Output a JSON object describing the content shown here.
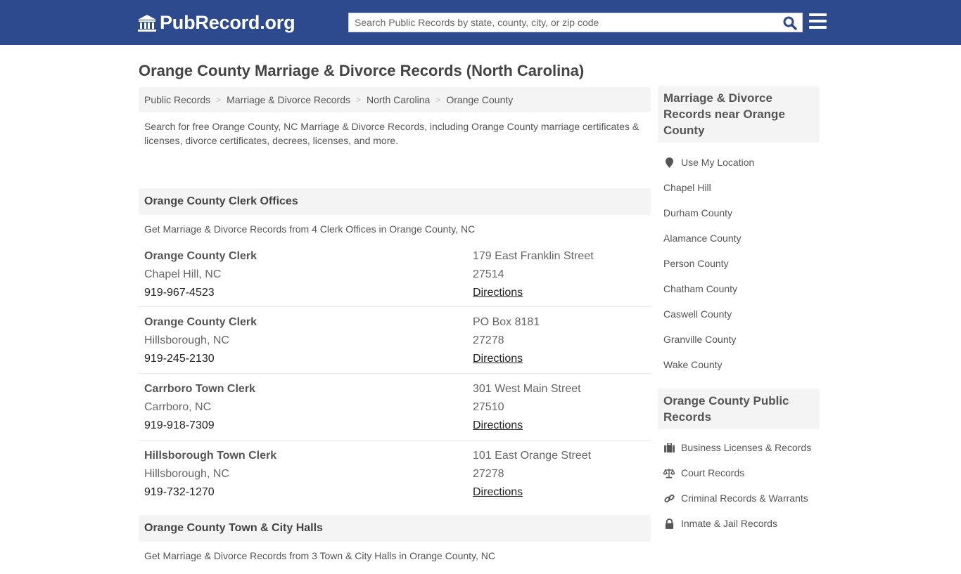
{
  "header": {
    "logo_text": "PubRecord.org",
    "search_placeholder": "Search Public Records by state, county, city, or zip code",
    "brand_color": "#2e4a8e"
  },
  "page_title": "Orange County Marriage & Divorce Records (North Carolina)",
  "breadcrumb": [
    {
      "label": "Public Records"
    },
    {
      "label": "Marriage & Divorce Records"
    },
    {
      "label": "North Carolina"
    },
    {
      "label": "Orange County"
    }
  ],
  "intro": "Search for free Orange County, NC Marriage & Divorce Records, including Orange County marriage certificates & licenses, divorce certificates, decrees, licenses, and more.",
  "clerk_section": {
    "title": "Orange County Clerk Offices",
    "subtitle": "Get Marriage & Divorce Records from 4 Clerk Offices in Orange County, NC",
    "offices": [
      {
        "name": "Orange County Clerk",
        "city": "Chapel Hill, NC",
        "phone": "919-967-4523",
        "address": "179 East Franklin Street",
        "zip": "27514",
        "link": "Directions"
      },
      {
        "name": "Orange County Clerk",
        "city": "Hillsborough, NC",
        "phone": "919-245-2130",
        "address": "PO Box 8181",
        "zip": "27278",
        "link": "Directions"
      },
      {
        "name": "Carrboro Town Clerk",
        "city": "Carrboro, NC",
        "phone": "919-918-7309",
        "address": "301 West Main Street",
        "zip": "27510",
        "link": "Directions"
      },
      {
        "name": "Hillsborough Town Clerk",
        "city": "Hillsborough, NC",
        "phone": "919-732-1270",
        "address": "101 East Orange Street",
        "zip": "27278",
        "link": "Directions"
      }
    ]
  },
  "halls_section": {
    "title": "Orange County Town & City Halls",
    "subtitle": "Get Marriage & Divorce Records from 3 Town & City Halls in Orange County, NC"
  },
  "sidebar": {
    "nearby_title": "Marriage & Divorce Records near Orange County",
    "location_label": "Use My Location",
    "nearby": [
      "Chapel Hill",
      "Durham County",
      "Alamance County",
      "Person County",
      "Chatham County",
      "Caswell County",
      "Granville County",
      "Wake County"
    ],
    "public_title": "Orange County Public Records",
    "public_links": [
      {
        "label": "Business Licenses & Records",
        "icon": "briefcase-icon"
      },
      {
        "label": "Court Records",
        "icon": "scale-icon"
      },
      {
        "label": "Criminal Records & Warrants",
        "icon": "link-icon"
      },
      {
        "label": "Inmate & Jail Records",
        "icon": "lock-icon"
      }
    ]
  }
}
